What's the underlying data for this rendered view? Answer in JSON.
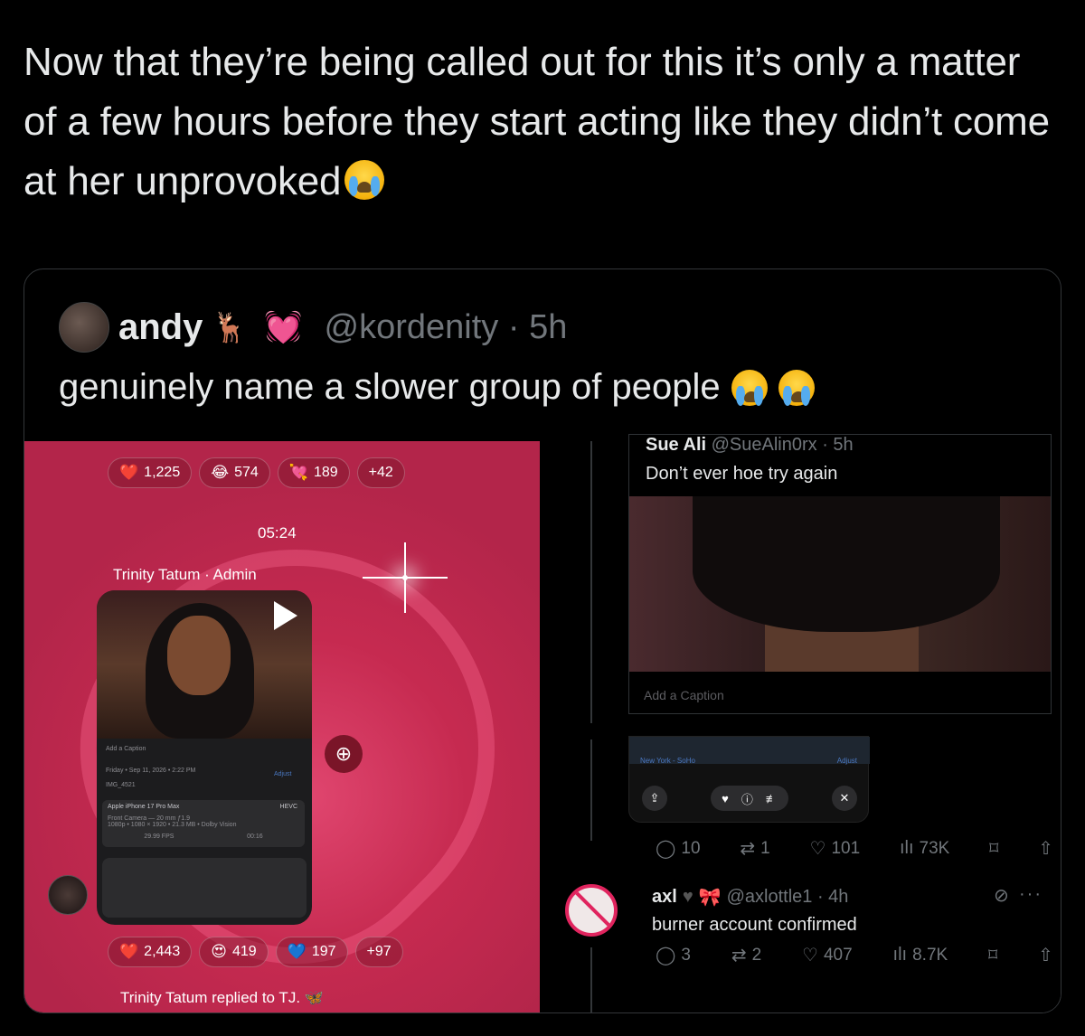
{
  "tweet": {
    "text": "Now that they’re being called out for this it’s only a matter of a few hours before they start acting like they didn’t come at her unprovoked"
  },
  "quote": {
    "name": "andy",
    "handle_time": "@kordenity · 5h",
    "text": "genuinely name a slower group of people"
  },
  "left_media": {
    "top_reactions": [
      {
        "icon": "❤️",
        "icon_name": "red-heart-icon",
        "count": "1,225"
      },
      {
        "icon": "😂",
        "icon_name": "laughing-icon",
        "count": "574"
      },
      {
        "icon": "💘",
        "icon_name": "heart-arrow-icon",
        "count": "189"
      },
      {
        "icon": "",
        "icon_name": "",
        "count": "+42"
      }
    ],
    "time": "05:24",
    "sender": "Trinity Tatum · Admin",
    "phone": {
      "caption_placeholder": "Add a Caption",
      "date": "Friday • Sep 11, 2026 • 2:22 PM",
      "file": "IMG_4521",
      "adjust": "Adjust",
      "device": "Apple iPhone 17 Pro Max",
      "format": "HEVC",
      "camera": "Front Camera — 20 mm ƒ1.9",
      "specs": "1080p • 1080 × 1920 • 21.3 MB • Dolby Vision",
      "fps": "29.99 FPS",
      "duration": "00:16"
    },
    "bottom_reactions": [
      {
        "icon": "❤️",
        "icon_name": "red-heart-icon",
        "count": "2,443"
      },
      {
        "icon": "😍",
        "icon_name": "heart-eyes-icon",
        "count": "419"
      },
      {
        "icon": "💙",
        "icon_name": "blue-heart-icon",
        "count": "197"
      },
      {
        "icon": "",
        "icon_name": "",
        "count": "+97"
      }
    ],
    "replied": "Trinity Tatum replied to TJ."
  },
  "right_media": {
    "retweet": {
      "name": "Sue Ali",
      "handle_time": "@SueAlin0rx · 5h",
      "text": "Don’t ever hoe try again",
      "caption_placeholder": "Add a Caption"
    },
    "map": {
      "location": "New York - SoHo",
      "adjust": "Adjust"
    },
    "actions1": {
      "replies": "10",
      "reposts": "1",
      "likes": "101",
      "views": "73K"
    },
    "reply": {
      "name": "axl",
      "handle_time": "@axlottle1 · 4h",
      "text": "burner account confirmed"
    },
    "actions2": {
      "replies": "3",
      "reposts": "2",
      "likes": "407",
      "views": "8.7K"
    }
  }
}
